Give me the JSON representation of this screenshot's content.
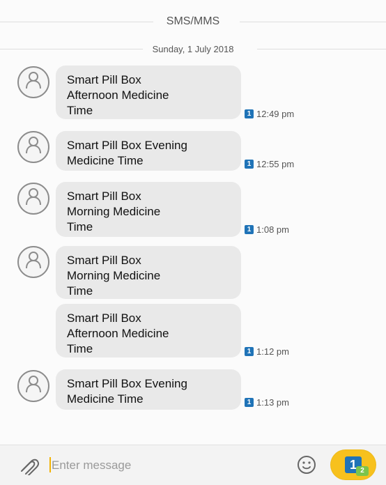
{
  "header": {
    "channel_label": "SMS/MMS",
    "date_label": "Sunday, 1 July 2018"
  },
  "messages": [
    {
      "text": "Smart Pill Box\nAfternoon Medicine\nTime",
      "time": "12:49 pm",
      "sim": "1"
    },
    {
      "text": "Smart Pill Box Evening\nMedicine Time",
      "time": "12:55 pm",
      "sim": "1"
    },
    {
      "text": "Smart Pill Box\nMorning Medicine\nTime",
      "time": "1:08 pm",
      "sim": "1"
    },
    {
      "text": "Smart Pill Box\nMorning Medicine\nTime"
    },
    {
      "text": "Smart Pill Box\nAfternoon Medicine\nTime",
      "time": "1:12 pm",
      "sim": "1"
    },
    {
      "text": "Smart Pill Box Evening\nMedicine Time",
      "time": "1:13 pm",
      "sim": "1"
    }
  ],
  "composer": {
    "placeholder": "Enter message",
    "value": "",
    "send_sim": "1",
    "send_sim_sub": "2"
  },
  "icons": {
    "contact_avatar": "contact-avatar-icon",
    "attach": "paperclip-icon",
    "emoji": "smiley-icon",
    "send": "sim-send-icon"
  },
  "colors": {
    "bubble": "#e9e9e9",
    "sim_badge": "#1f73b7",
    "send_button": "#f7c11d",
    "send_sub_badge": "#7cc44b"
  }
}
